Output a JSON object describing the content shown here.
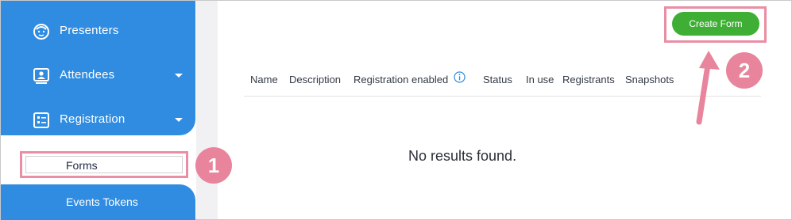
{
  "sidebar": {
    "items": [
      {
        "label": "Presenters",
        "icon": "face-icon",
        "has_caret": false
      },
      {
        "label": "Attendees",
        "icon": "attendees-icon",
        "has_caret": true
      },
      {
        "label": "Registration",
        "icon": "registration-list-icon",
        "has_caret": true
      }
    ],
    "sub_items": [
      {
        "label": "Forms",
        "selected": true
      },
      {
        "label": "Events Tokens"
      }
    ]
  },
  "toolbar": {
    "create_form_label": "Create Form"
  },
  "table": {
    "columns": [
      "Name",
      "Description",
      "Registration enabled",
      "Status",
      "In use",
      "Registrants",
      "Snapshots"
    ],
    "empty_text": "No results found."
  },
  "annotations": {
    "badge_1": "1",
    "badge_2": "2"
  },
  "colors": {
    "sidebar": "#2f8ce0",
    "create_button": "#3fae35",
    "annotation": "#e8849c"
  }
}
